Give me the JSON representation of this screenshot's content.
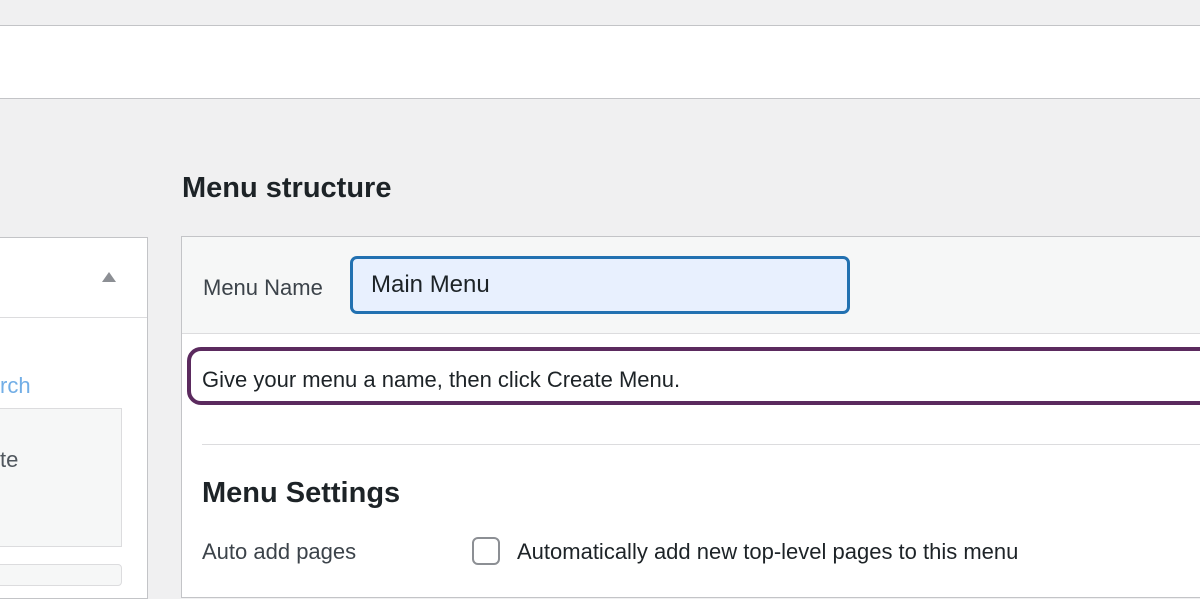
{
  "left_panel": {
    "link_fragment": "rch",
    "text_fragment": "te"
  },
  "menu_structure": {
    "title": "Menu structure",
    "menu_name_label": "Menu Name",
    "menu_name_value": "Main Menu",
    "instruction": "Give your menu a name, then click Create Menu."
  },
  "menu_settings": {
    "title": "Menu Settings",
    "auto_add_label": "Auto add pages",
    "auto_add_checkbox_label": "Automatically add new top-level pages to this menu",
    "auto_add_checked": false
  },
  "colors": {
    "accent": "#2271b1",
    "highlight_border": "#5b2a5e",
    "link": "#72aee6"
  },
  "icons": {
    "collapse": "triangle-up-icon"
  }
}
